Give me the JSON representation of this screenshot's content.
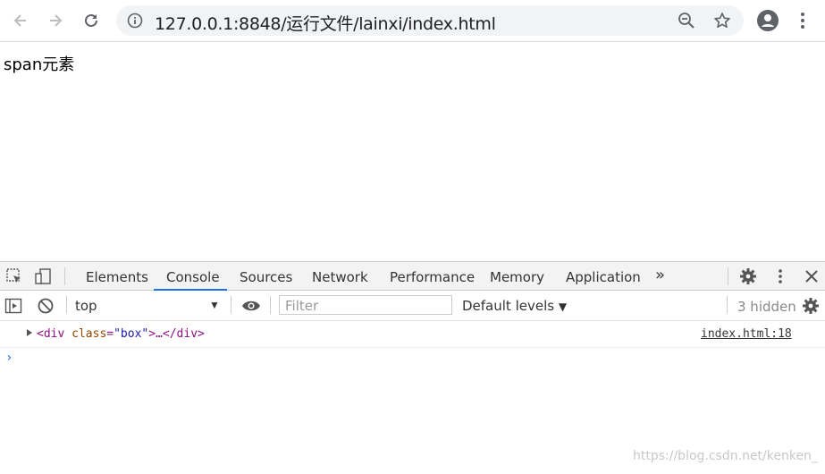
{
  "browser": {
    "url": "127.0.0.1:8848/运行文件/lainxi/index.html",
    "icons": [
      "back-arrow-icon",
      "forward-arrow-icon",
      "reload-icon",
      "info-icon",
      "zoom-out-icon",
      "star-icon",
      "account-icon",
      "kebab-menu-icon"
    ]
  },
  "page": {
    "text": "span元素"
  },
  "devtools": {
    "tabs": [
      "Elements",
      "Console",
      "Sources",
      "Network",
      "Performance",
      "Memory",
      "Application"
    ],
    "active_tab": "Console",
    "more": "»",
    "context": "top",
    "filter_placeholder": "Filter",
    "levels": "Default levels",
    "hidden": "3 hidden",
    "log": {
      "tag_open": "<div",
      "attr_name": "class",
      "attr_eq": "=",
      "attr_value": "\"box\"",
      "tag_close": ">…</div>",
      "source": "index.html:18"
    },
    "prompt": "›"
  },
  "watermark": "https://blog.csdn.net/kenken_"
}
